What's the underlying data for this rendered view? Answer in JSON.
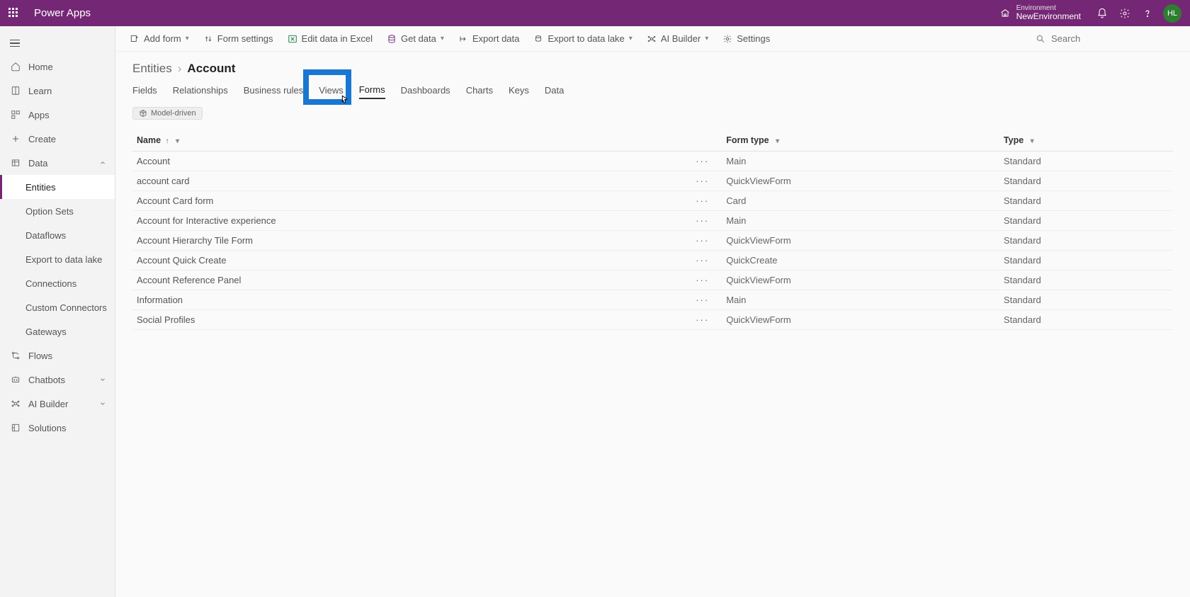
{
  "header": {
    "app_title": "Power Apps",
    "env_label": "Environment",
    "env_name": "NewEnvironment",
    "avatar_initials": "HL"
  },
  "sidebar": {
    "items": [
      {
        "id": "home",
        "label": "Home"
      },
      {
        "id": "learn",
        "label": "Learn"
      },
      {
        "id": "apps",
        "label": "Apps"
      },
      {
        "id": "create",
        "label": "Create"
      },
      {
        "id": "data",
        "label": "Data",
        "expandable": true,
        "expanded": true
      },
      {
        "id": "entities",
        "label": "Entities",
        "sub": true,
        "active": true
      },
      {
        "id": "option-sets",
        "label": "Option Sets",
        "sub": true
      },
      {
        "id": "dataflows",
        "label": "Dataflows",
        "sub": true
      },
      {
        "id": "export-data-lake",
        "label": "Export to data lake",
        "sub": true
      },
      {
        "id": "connections",
        "label": "Connections",
        "sub": true
      },
      {
        "id": "custom-connectors",
        "label": "Custom Connectors",
        "sub": true
      },
      {
        "id": "gateways",
        "label": "Gateways",
        "sub": true
      },
      {
        "id": "flows",
        "label": "Flows"
      },
      {
        "id": "chatbots",
        "label": "Chatbots",
        "expandable": true
      },
      {
        "id": "ai-builder",
        "label": "AI Builder",
        "expandable": true
      },
      {
        "id": "solutions",
        "label": "Solutions"
      }
    ]
  },
  "commandbar": {
    "add_form": "Add form",
    "form_settings": "Form settings",
    "edit_excel": "Edit data in Excel",
    "get_data": "Get data",
    "export_data": "Export data",
    "export_lake": "Export to data lake",
    "ai_builder": "AI Builder",
    "settings": "Settings",
    "search_placeholder": "Search"
  },
  "breadcrumb": {
    "parent": "Entities",
    "current": "Account"
  },
  "tabs": [
    {
      "id": "fields",
      "label": "Fields"
    },
    {
      "id": "relationships",
      "label": "Relationships"
    },
    {
      "id": "business-rules",
      "label": "Business rules"
    },
    {
      "id": "views",
      "label": "Views"
    },
    {
      "id": "forms",
      "label": "Forms",
      "active": true
    },
    {
      "id": "dashboards",
      "label": "Dashboards"
    },
    {
      "id": "charts",
      "label": "Charts"
    },
    {
      "id": "keys",
      "label": "Keys"
    },
    {
      "id": "data",
      "label": "Data"
    }
  ],
  "chip": {
    "label": "Model-driven"
  },
  "table": {
    "headers": {
      "name": "Name",
      "form_type": "Form type",
      "type": "Type"
    },
    "rows": [
      {
        "name": "Account",
        "form_type": "Main",
        "type": "Standard"
      },
      {
        "name": "account card",
        "form_type": "QuickViewForm",
        "type": "Standard"
      },
      {
        "name": "Account Card form",
        "form_type": "Card",
        "type": "Standard"
      },
      {
        "name": "Account for Interactive experience",
        "form_type": "Main",
        "type": "Standard"
      },
      {
        "name": "Account Hierarchy Tile Form",
        "form_type": "QuickViewForm",
        "type": "Standard"
      },
      {
        "name": "Account Quick Create",
        "form_type": "QuickCreate",
        "type": "Standard"
      },
      {
        "name": "Account Reference Panel",
        "form_type": "QuickViewForm",
        "type": "Standard"
      },
      {
        "name": "Information",
        "form_type": "Main",
        "type": "Standard"
      },
      {
        "name": "Social Profiles",
        "form_type": "QuickViewForm",
        "type": "Standard"
      }
    ]
  }
}
